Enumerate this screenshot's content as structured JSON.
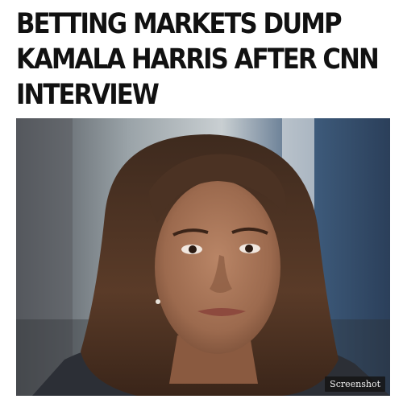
{
  "headline": {
    "lines": [
      "BETTING MARKETS DUMP",
      "KAMALA HARRIS AFTER CNN",
      "INTERVIEW"
    ]
  },
  "photo": {
    "badge": "Screenshot"
  }
}
